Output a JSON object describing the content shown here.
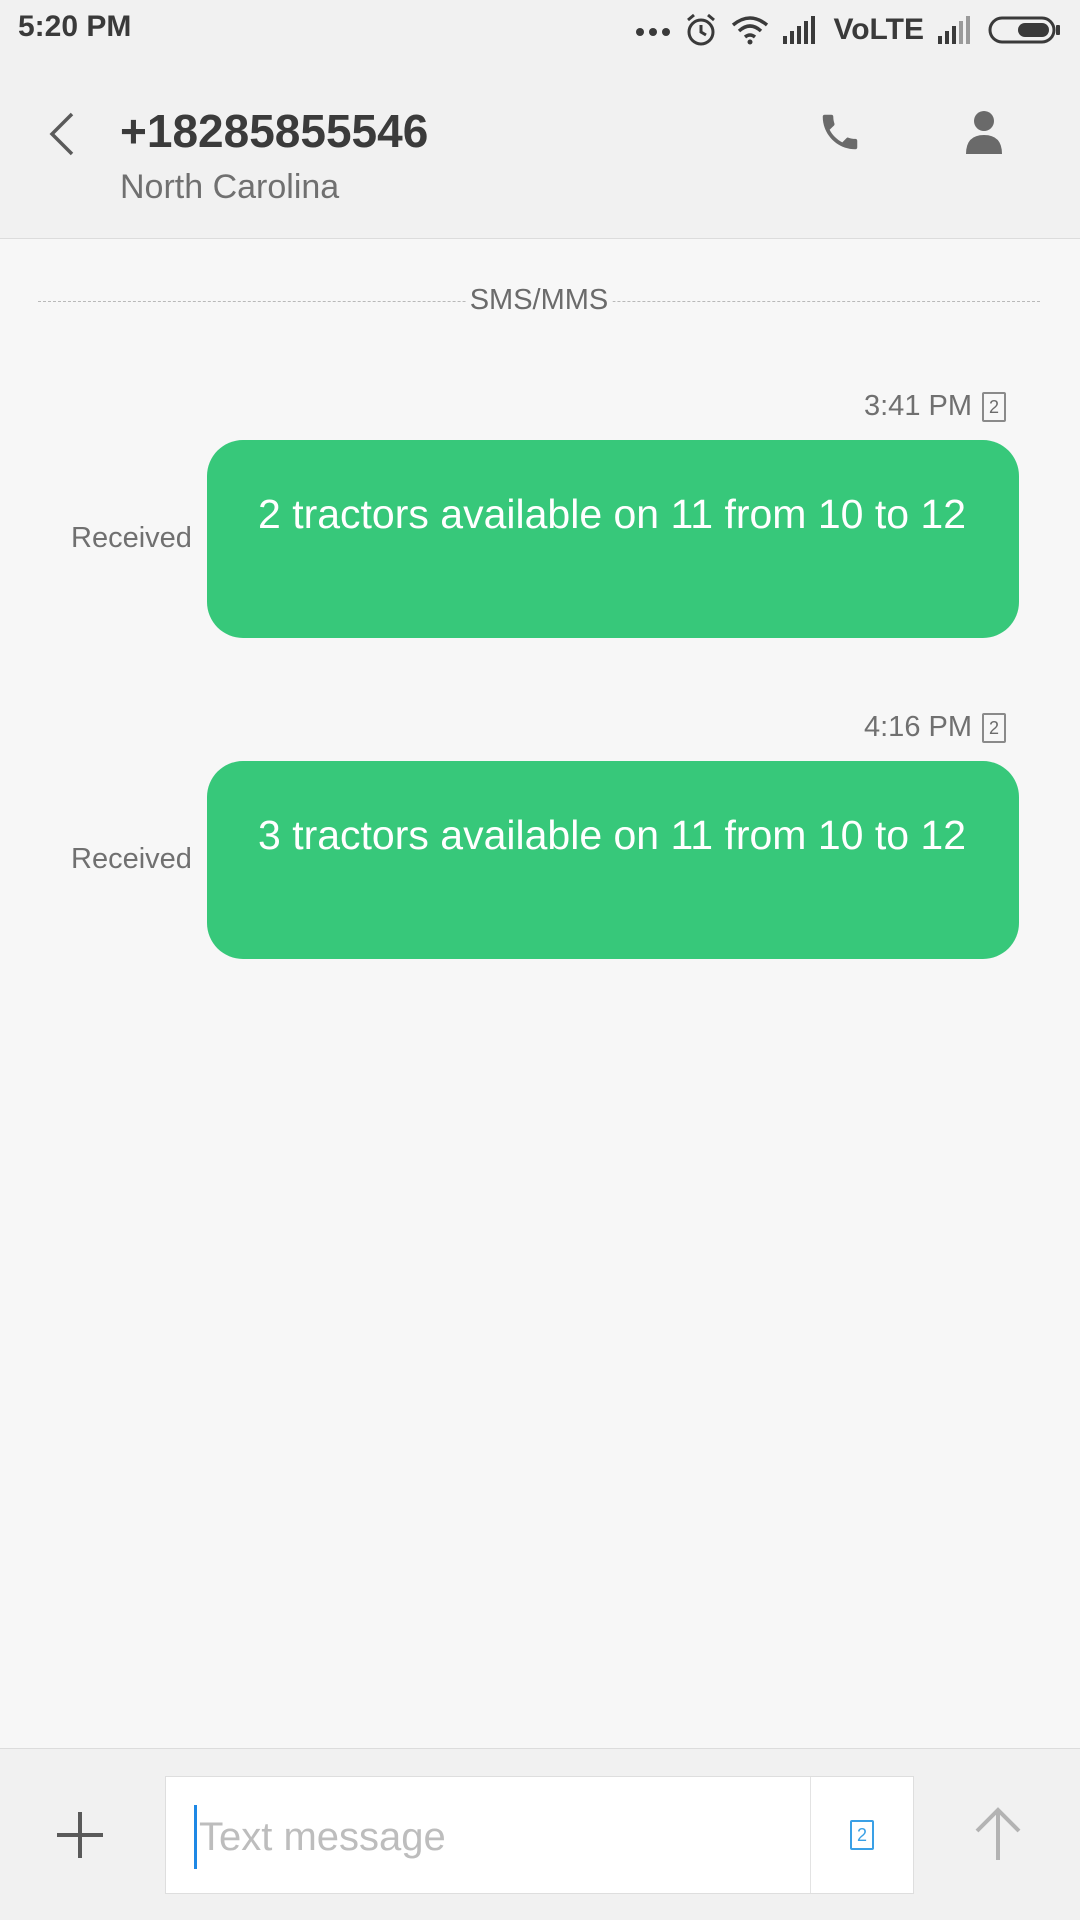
{
  "status_bar": {
    "time": "5:20 PM",
    "network_label": "VoLTE",
    "icons": [
      "more-dots-icon",
      "alarm-icon",
      "wifi-icon",
      "signal-icon",
      "signal-icon-2",
      "battery-icon"
    ]
  },
  "header": {
    "contact_number": "+18285855546",
    "contact_location": "North Carolina",
    "icons": [
      "back-arrow-icon",
      "phone-icon",
      "person-icon"
    ]
  },
  "conversation": {
    "channel_label": "SMS/MMS",
    "messages": [
      {
        "time": "3:41 PM",
        "sim": "2",
        "status": "Received",
        "text": "2 tractors available on 11 from 10 to 12"
      },
      {
        "time": "4:16 PM",
        "sim": "2",
        "status": "Received",
        "text": "3 tractors available on 11 from 10 to 12"
      }
    ]
  },
  "composer": {
    "placeholder": "Text message",
    "sim": "2",
    "icons": [
      "plus-icon",
      "sim-icon",
      "send-arrow-icon"
    ]
  },
  "colors": {
    "bubble": "#37c87a",
    "accent": "#3aa0e6"
  }
}
